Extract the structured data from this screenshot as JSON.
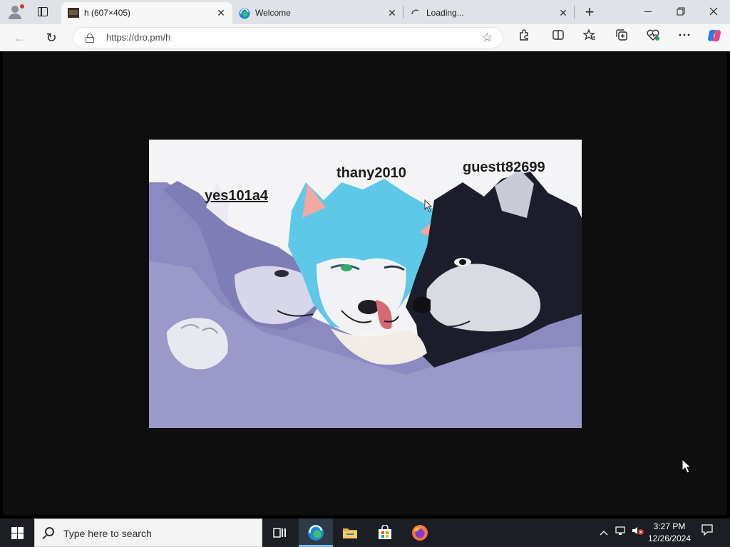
{
  "browser": {
    "tabs": [
      {
        "title": "h (607×405)",
        "active": true,
        "close": "✕"
      },
      {
        "title": "Welcome",
        "active": false,
        "close": "✕"
      },
      {
        "title": "Loading...",
        "active": false,
        "close": "✕"
      }
    ],
    "new_tab": "+",
    "window_controls": {
      "minimize": "—",
      "restore": "❐",
      "close": "✕"
    },
    "address": {
      "url": "https://dro.pm/h"
    },
    "nav": {
      "back": "←",
      "refresh": "↻"
    },
    "toolbar_icons": [
      "extensions-icon",
      "split-screen-icon",
      "favorites-icon",
      "collections-icon",
      "browser-essentials-icon",
      "more-icon",
      "copilot-icon"
    ]
  },
  "page": {
    "image_labels": [
      "yes101a4",
      "thany2010",
      "guestt82699"
    ],
    "image_bg": "#f4f4f6"
  },
  "taskbar": {
    "search_placeholder": "Type here to search",
    "apps": [
      "task-view",
      "edge",
      "file-explorer",
      "microsoft-store",
      "firefox"
    ],
    "time": "3:27 PM",
    "date": "12/26/2024"
  },
  "colors": {
    "tabstrip": "#dfe3e8",
    "toolbar": "#f7f7f7",
    "taskbar": "#1b1f24",
    "edge_blue": "#1a8ad4",
    "accent": "#76b9ed"
  }
}
